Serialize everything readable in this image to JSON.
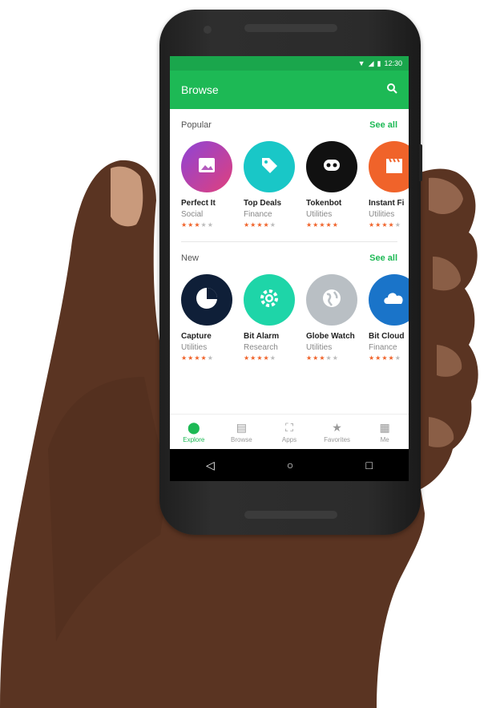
{
  "status": {
    "time": "12:30"
  },
  "appbar": {
    "title": "Browse",
    "search_icon": "search-icon"
  },
  "sections": [
    {
      "title": "Popular",
      "link": "See all",
      "apps": [
        {
          "name": "Perfect It",
          "category": "Social",
          "rating": 3,
          "color": "#8e44d6",
          "color2": "#e0407c",
          "icon": "image-icon"
        },
        {
          "name": "Top Deals",
          "category": "Finance",
          "rating": 4,
          "color": "#19c7c7",
          "color2": "#19c7c7",
          "icon": "tag-icon"
        },
        {
          "name": "Tokenbot",
          "category": "Utilities",
          "rating": 5,
          "color": "#111111",
          "color2": "#111111",
          "icon": "robot-icon"
        },
        {
          "name": "Instant Fi",
          "category": "Utilities",
          "rating": 4,
          "color": "#f0632a",
          "color2": "#f0632a",
          "icon": "clapper-icon"
        }
      ]
    },
    {
      "title": "New",
      "link": "See all",
      "apps": [
        {
          "name": "Capture",
          "category": "Utilities",
          "rating": 4,
          "color": "#0f1f38",
          "color2": "#0f1f38",
          "icon": "pie-chart-icon"
        },
        {
          "name": "Bit Alarm",
          "category": "Research",
          "rating": 4,
          "color": "#1ed5a8",
          "color2": "#1ed5a8",
          "icon": "gear-icon"
        },
        {
          "name": "Globe Watch",
          "category": "Utilities",
          "rating": 3,
          "color": "#b9bfc4",
          "color2": "#b9bfc4",
          "icon": "globe-icon"
        },
        {
          "name": "Bit Cloud",
          "category": "Finance",
          "rating": 4,
          "color": "#1a74c9",
          "color2": "#1a74c9",
          "icon": "cloud-icon"
        }
      ]
    }
  ],
  "tabs": [
    {
      "label": "Explore",
      "icon": "compass-icon",
      "active": true
    },
    {
      "label": "Browse",
      "icon": "chat-icon",
      "active": false
    },
    {
      "label": "Apps",
      "icon": "frame-icon",
      "active": false
    },
    {
      "label": "Favorites",
      "icon": "star-icon",
      "active": false
    },
    {
      "label": "Me",
      "icon": "profile-icon",
      "active": false
    }
  ],
  "colors": {
    "accent": "#1db955",
    "status_bar": "#1aa64c",
    "stars": "#f0632a"
  }
}
